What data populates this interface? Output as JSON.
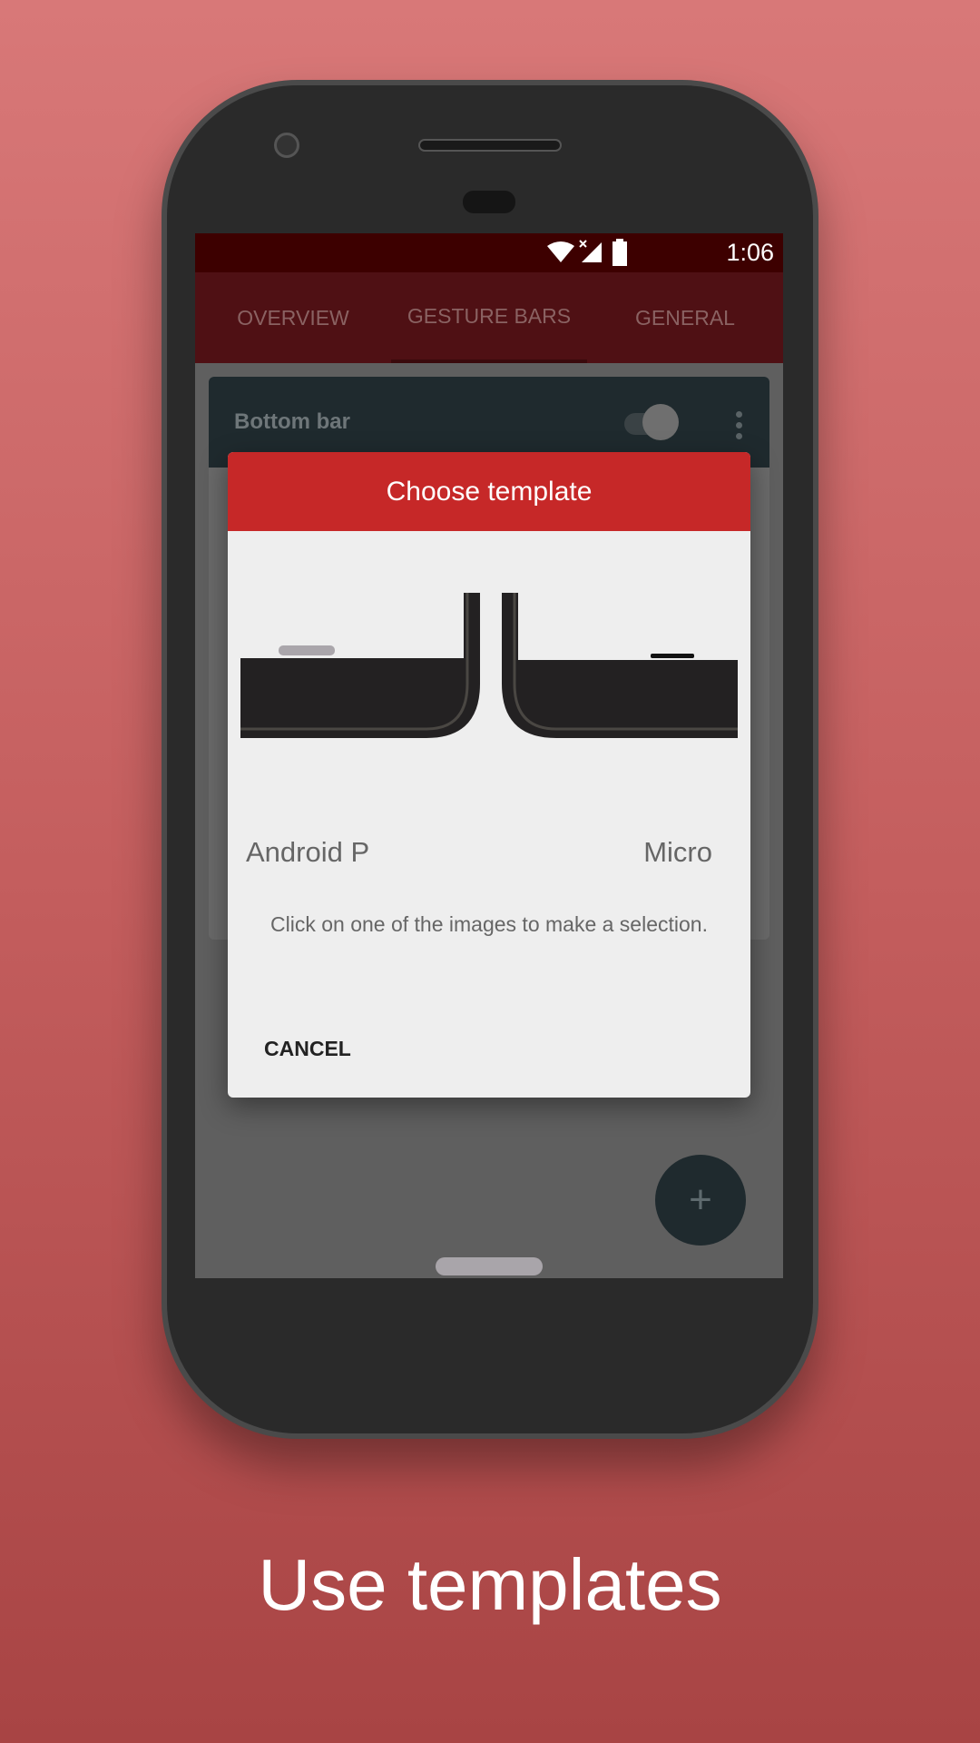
{
  "status_bar": {
    "time": "1:06",
    "icons": [
      "wifi-icon",
      "signal-no-data-icon",
      "battery-icon"
    ]
  },
  "tabs": [
    {
      "label": "OVERVIEW"
    },
    {
      "label": "GESTURE BARS",
      "active": true
    },
    {
      "label": "GENERAL"
    }
  ],
  "card": {
    "title": "Bottom bar",
    "toggle_on": true
  },
  "fab": {
    "icon": "plus-icon",
    "label": "+"
  },
  "dialog": {
    "title": "Choose template",
    "options": [
      {
        "label": "Android P"
      },
      {
        "label": "Micro"
      }
    ],
    "message": "Click on one of the images to make a selection.",
    "cancel_label": "CANCEL"
  },
  "caption": "Use templates",
  "colors": {
    "accent": "#c62828",
    "status_bar": "#3d0000",
    "tab_bar": "#4f1014",
    "background_top": "#d87878",
    "background_bottom": "#a84444"
  }
}
